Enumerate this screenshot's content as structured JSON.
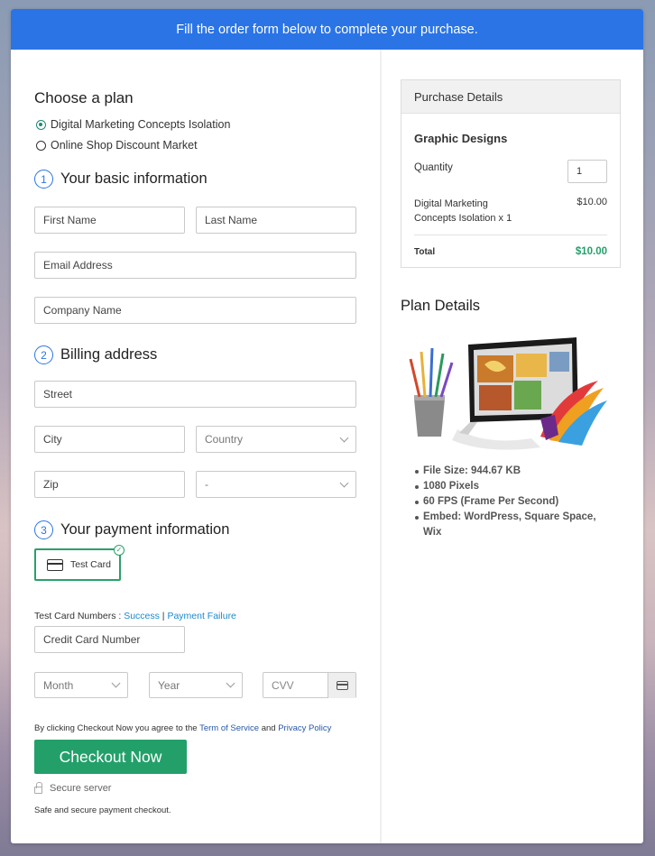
{
  "banner": "Fill the order form below to complete your purchase.",
  "plan": {
    "heading": "Choose a plan",
    "options": [
      {
        "label": "Digital Marketing Concepts Isolation",
        "selected": true
      },
      {
        "label": "Online Shop Discount Market",
        "selected": false
      }
    ]
  },
  "basic": {
    "number": "1",
    "heading": "Your basic information",
    "first_name": "First Name",
    "last_name": "Last Name",
    "email": "Email Address",
    "company": "Company Name"
  },
  "billing": {
    "number": "2",
    "heading": "Billing address",
    "street": "Street",
    "city": "City",
    "country": "Country",
    "zip": "Zip",
    "state": "-"
  },
  "payment": {
    "number": "3",
    "heading": "Your payment information",
    "method_label": "Test Card",
    "test_numbers_prefix": "Test Card Numbers : ",
    "success_link": "Success",
    "separator": " | ",
    "failure_link": "Payment Failure",
    "card_number": "Credit Card Number",
    "month": "Month",
    "year": "Year",
    "cvv": "CVV"
  },
  "agreement": {
    "prefix": "By clicking Checkout Now you agree to the ",
    "terms_link": "Term of Service",
    "and": " and ",
    "privacy_link": "Privacy Policy"
  },
  "checkout_button": "Checkout Now",
  "secure_label": "Secure server",
  "safe_note": "Safe and secure payment checkout.",
  "purchase": {
    "heading": "Purchase Details",
    "product": "Graphic Designs",
    "quantity_label": "Quantity",
    "quantity_value": "1",
    "item": "Digital Marketing Concepts Isolation x 1",
    "item_price": "$10.00",
    "total_label": "Total",
    "total_value": "$10.00"
  },
  "plan_details": {
    "heading": "Plan Details",
    "bullets": [
      "File Size: 944.67 KB",
      "1080 Pixels",
      "60 FPS (Frame Per Second)",
      "Embed: WordPress, Square Space, Wix"
    ]
  },
  "colors": {
    "header_blue": "#2a74e6",
    "accent_green": "#23a06a",
    "link_blue": "#1a8ad0"
  }
}
